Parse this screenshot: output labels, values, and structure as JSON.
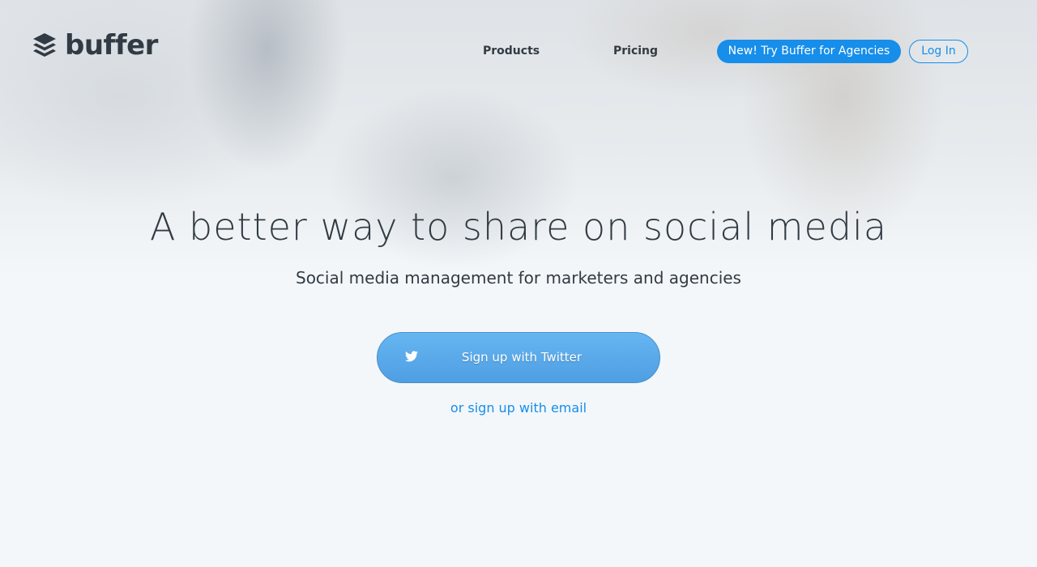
{
  "brand": {
    "name": "buffer"
  },
  "nav": {
    "products_label": "Products",
    "pricing_label": "Pricing",
    "agencies_label": "New! Try Buffer for Agencies",
    "login_label": "Log In"
  },
  "hero": {
    "headline": "A better way to share on social media",
    "subheadline": "Social media management for marketers and agencies",
    "twitter_signup_label": "Sign up with Twitter",
    "email_signup_label": "or sign up with email"
  },
  "icons": {
    "logo": "buffer-layers-icon",
    "twitter": "twitter-bird-icon"
  },
  "colors": {
    "accent": "#168eea",
    "text": "#323b43",
    "twitter_button": "#5aaaea",
    "page_background": "#f3f7fa"
  }
}
